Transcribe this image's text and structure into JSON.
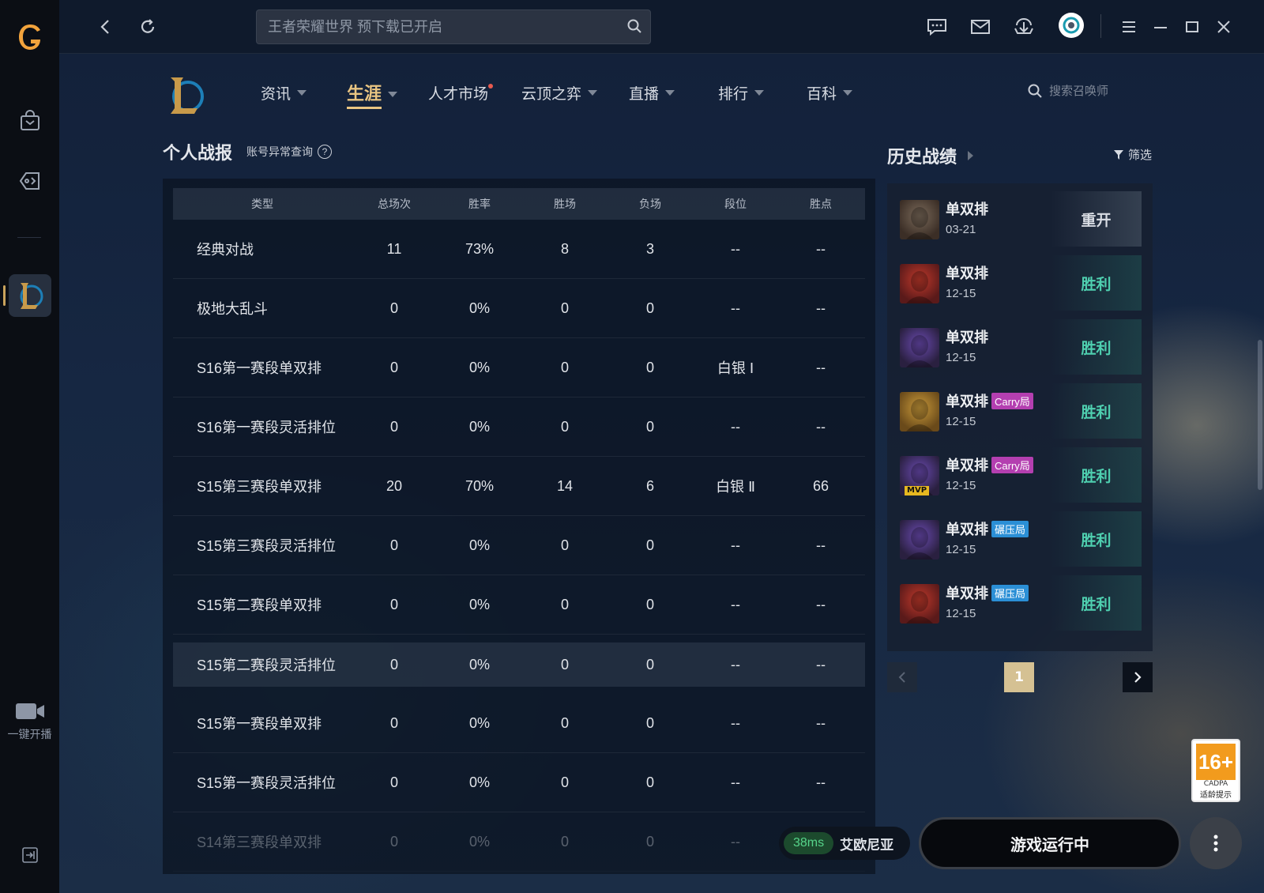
{
  "topbar": {
    "search_placeholder": "王者荣耀世界 预下载已开启"
  },
  "nav": {
    "items": [
      {
        "label": "资讯"
      },
      {
        "label": "生涯"
      },
      {
        "label": "人才市场"
      },
      {
        "label": "云顶之弈"
      },
      {
        "label": "直播"
      },
      {
        "label": "排行"
      },
      {
        "label": "百科"
      }
    ],
    "summoner_search_placeholder": "搜索召唤师"
  },
  "sidebar": {
    "live_label": "一键开播"
  },
  "stats": {
    "title": "个人战报",
    "account_check": "账号异常查询",
    "help": "?",
    "columns": [
      "类型",
      "总场次",
      "胜率",
      "胜场",
      "负场",
      "段位",
      "胜点"
    ],
    "rows": [
      [
        "经典对战",
        "11",
        "73%",
        "8",
        "3",
        "--",
        "--"
      ],
      [
        "极地大乱斗",
        "0",
        "0%",
        "0",
        "0",
        "--",
        "--"
      ],
      [
        "S16第一赛段单双排",
        "0",
        "0%",
        "0",
        "0",
        "白银 Ⅰ",
        "--"
      ],
      [
        "S16第一赛段灵活排位",
        "0",
        "0%",
        "0",
        "0",
        "--",
        "--"
      ],
      [
        "S15第三赛段单双排",
        "20",
        "70%",
        "14",
        "6",
        "白银 Ⅱ",
        "66"
      ],
      [
        "S15第三赛段灵活排位",
        "0",
        "0%",
        "0",
        "0",
        "--",
        "--"
      ],
      [
        "S15第二赛段单双排",
        "0",
        "0%",
        "0",
        "0",
        "--",
        "--"
      ],
      [
        "S15第二赛段灵活排位",
        "0",
        "0%",
        "0",
        "0",
        "--",
        "--"
      ],
      [
        "S15第一赛段单双排",
        "0",
        "0%",
        "0",
        "0",
        "--",
        "--"
      ],
      [
        "S15第一赛段灵活排位",
        "0",
        "0%",
        "0",
        "0",
        "--",
        "--"
      ],
      [
        "S14第三赛段单双排",
        "0",
        "0%",
        "0",
        "0",
        "--",
        "--"
      ]
    ]
  },
  "history": {
    "title": "历史战绩",
    "filter": "筛选",
    "items": [
      {
        "mode": "单双排",
        "date": "03-21",
        "result": "重开",
        "tag": ""
      },
      {
        "mode": "单双排",
        "date": "12-15",
        "result": "胜利",
        "tag": ""
      },
      {
        "mode": "单双排",
        "date": "12-15",
        "result": "胜利",
        "tag": ""
      },
      {
        "mode": "单双排",
        "date": "12-15",
        "result": "胜利",
        "tag": "Carry局"
      },
      {
        "mode": "单双排",
        "date": "12-15",
        "result": "胜利",
        "tag": "Carry局",
        "mvp": "MVP"
      },
      {
        "mode": "单双排",
        "date": "12-15",
        "result": "胜利",
        "tag": "碾压局"
      },
      {
        "mode": "单双排",
        "date": "12-15",
        "result": "胜利",
        "tag": "碾压局"
      }
    ],
    "page": "1"
  },
  "age_rating": {
    "number": "16+",
    "org": "CADPA",
    "label": "适龄提示"
  },
  "bottom": {
    "ping": "38ms",
    "server": "艾欧尼亚",
    "play_button": "游戏运行中"
  },
  "colors": {
    "accent_gold": "#e9c582",
    "win_green": "#4fd0b0",
    "carry_tag": "#b43fb0",
    "crush_tag": "#2b8fd6"
  }
}
